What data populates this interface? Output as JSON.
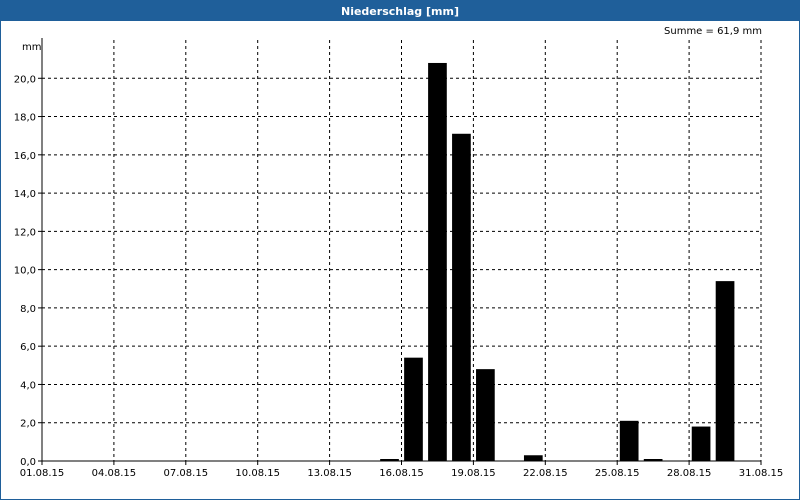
{
  "window": {
    "title": "Niederschlag [mm]"
  },
  "summary": "Summe = 61,9 mm",
  "chart_data": {
    "type": "bar",
    "title": "Niederschlag [mm]",
    "ylabel": "mm",
    "ylim": [
      0,
      22
    ],
    "yticks": [
      0,
      2,
      4,
      6,
      8,
      10,
      12,
      14,
      16,
      18,
      20
    ],
    "ytick_labels": [
      "0,0",
      "2,0",
      "4,0",
      "6,0",
      "8,0",
      "10,0",
      "12,0",
      "14,0",
      "16,0",
      "18,0",
      "20,0"
    ],
    "xtick_labels": [
      "01.08.15",
      "04.08.15",
      "07.08.15",
      "10.08.15",
      "13.08.15",
      "16.08.15",
      "19.08.15",
      "22.08.15",
      "25.08.15",
      "28.08.15",
      "31.08.15"
    ],
    "grid": true,
    "categories": [
      "01.08.15",
      "02.08.15",
      "03.08.15",
      "04.08.15",
      "05.08.15",
      "06.08.15",
      "07.08.15",
      "08.08.15",
      "09.08.15",
      "10.08.15",
      "11.08.15",
      "12.08.15",
      "13.08.15",
      "14.08.15",
      "15.08.15",
      "16.08.15",
      "17.08.15",
      "18.08.15",
      "19.08.15",
      "20.08.15",
      "21.08.15",
      "22.08.15",
      "23.08.15",
      "24.08.15",
      "25.08.15",
      "26.08.15",
      "27.08.15",
      "28.08.15",
      "29.08.15",
      "30.08.15"
    ],
    "values": [
      0,
      0,
      0,
      0,
      0,
      0,
      0,
      0,
      0,
      0,
      0,
      0,
      0,
      0,
      0.1,
      5.4,
      20.8,
      17.1,
      4.8,
      0,
      0.3,
      0,
      0,
      0,
      2.1,
      0.1,
      0,
      1.8,
      9.4,
      0
    ],
    "colors": {
      "bar": "#000000",
      "grid": "#000000",
      "frame": "#1f5f9a"
    }
  }
}
